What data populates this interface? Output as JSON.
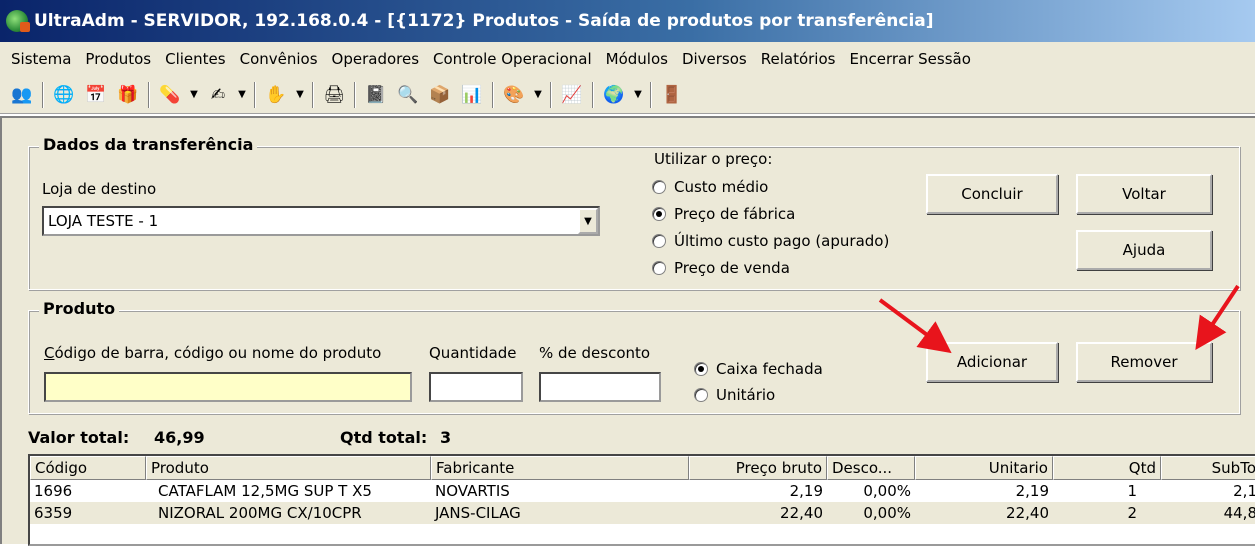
{
  "window": {
    "title": "UltraAdm - SERVIDOR, 192.168.0.4 - [{1172} Produtos - Saída de produtos por transferência]"
  },
  "menu": [
    "Sistema",
    "Produtos",
    "Clientes",
    "Convênios",
    "Operadores",
    "Controle Operacional",
    "Módulos",
    "Diversos",
    "Relatórios",
    "Encerrar Sessão"
  ],
  "transfer": {
    "group_title": "Dados da transferência",
    "store_label": "Loja de destino",
    "store_value": "LOJA TESTE - 1",
    "price_label": "Utilizar o preço:",
    "price_options": [
      "Custo médio",
      "Preço de fábrica",
      "Último custo pago (apurado)",
      "Preço de venda"
    ],
    "price_selected": "Preço de fábrica"
  },
  "buttons": {
    "conclude": "Concluir",
    "back": "Voltar",
    "help": "Ajuda",
    "add": "Adicionar",
    "remove": "Remover"
  },
  "product": {
    "group_title": "Produto",
    "code_label_first": "C",
    "code_label_rest": "ódigo de barra, código ou nome do produto",
    "quantity_label": "Quantidade",
    "discount_label": "% de desconto",
    "code_value": "",
    "quantity_value": "",
    "discount_value": "",
    "pack_options": [
      "Caixa fechada",
      "Unitário"
    ],
    "pack_selected": "Caixa fechada"
  },
  "summary": {
    "total_label": "Valor total:",
    "total_value": "46,99",
    "qty_label": "Qtd total:",
    "qty_value": "3"
  },
  "table": {
    "columns": [
      "Código",
      "Produto",
      "Fabricante",
      "Preço bruto",
      "Desco...",
      "Unitario",
      "Qtd",
      "SubTo"
    ],
    "rows": [
      [
        "1696",
        "CATAFLAM 12,5MG SUP T X5",
        "NOVARTIS",
        "2,19",
        "0,00%",
        "2,19",
        "1",
        "2,1"
      ],
      [
        "6359",
        "NIZORAL 200MG CX/10CPR",
        "JANS-CILAG",
        "22,40",
        "0,00%",
        "22,40",
        "2",
        "44,8"
      ]
    ]
  },
  "colors": {
    "title_bar": "#0a246a",
    "window_face": "#ece9d8",
    "input_highlight": "#ffffc8",
    "annotation_arrow": "#e8141c"
  }
}
